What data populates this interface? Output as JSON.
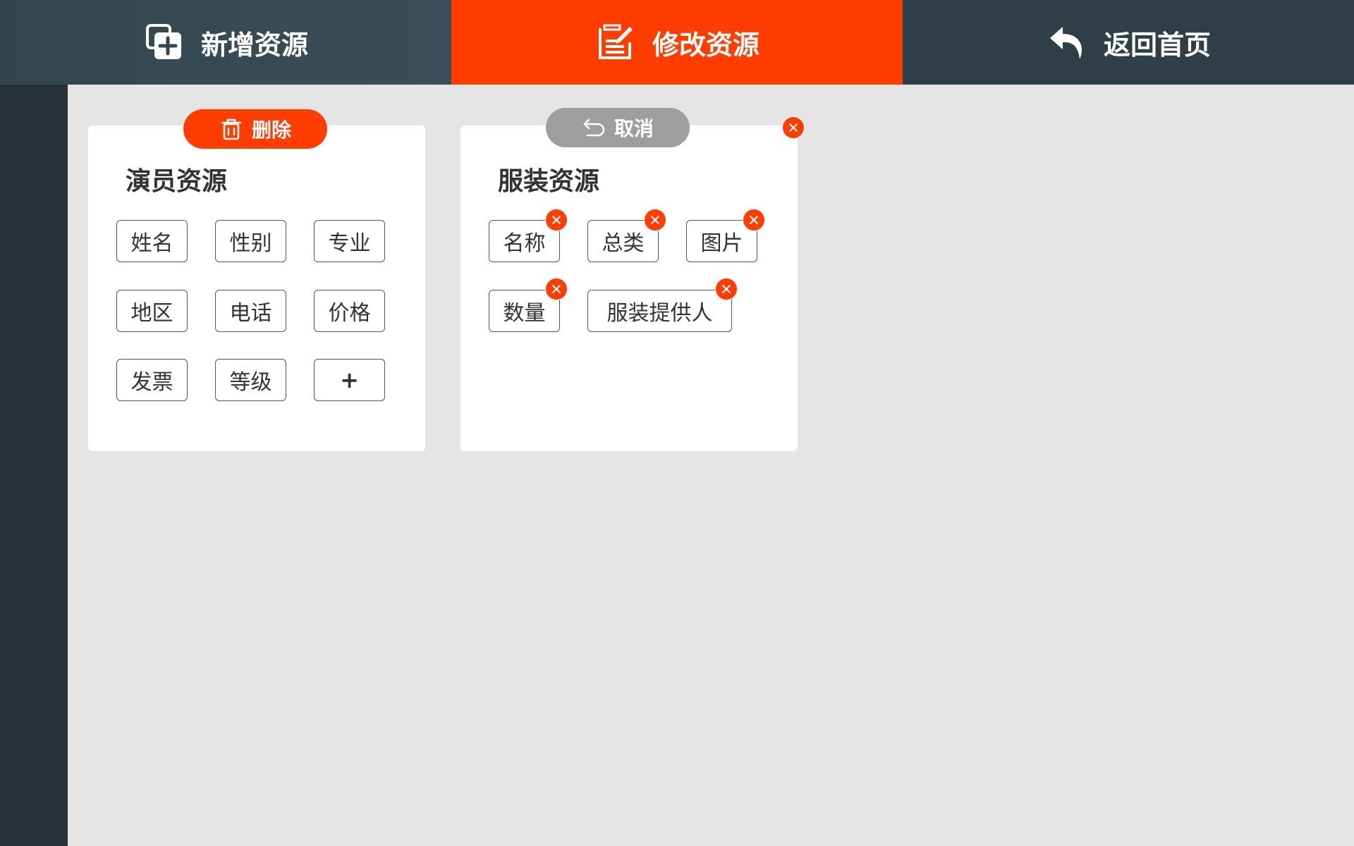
{
  "nav": {
    "tabs": [
      {
        "label": "新增资源",
        "icon": "add-copy-icon",
        "active": false
      },
      {
        "label": "修改资源",
        "icon": "edit-document-icon",
        "active": true
      },
      {
        "label": "返回首页",
        "icon": "undo-arrow-icon",
        "active": false
      }
    ]
  },
  "colors": {
    "accent": "#ff3d00",
    "nav_dark": "#2f3f48",
    "sidebar": "#263238",
    "cancel": "#9e9e9e",
    "background": "#e5e5e5"
  },
  "card_actor": {
    "title": "演员资源",
    "delete_label": "删除",
    "tags": [
      "姓名",
      "性别",
      "专业",
      "地区",
      "电话",
      "价格",
      "发票",
      "等级"
    ],
    "add_label": "+"
  },
  "card_costume": {
    "title": "服装资源",
    "cancel_label": "取消",
    "tags": [
      "名称",
      "总类",
      "图片",
      "数量",
      "服装提供人"
    ]
  }
}
